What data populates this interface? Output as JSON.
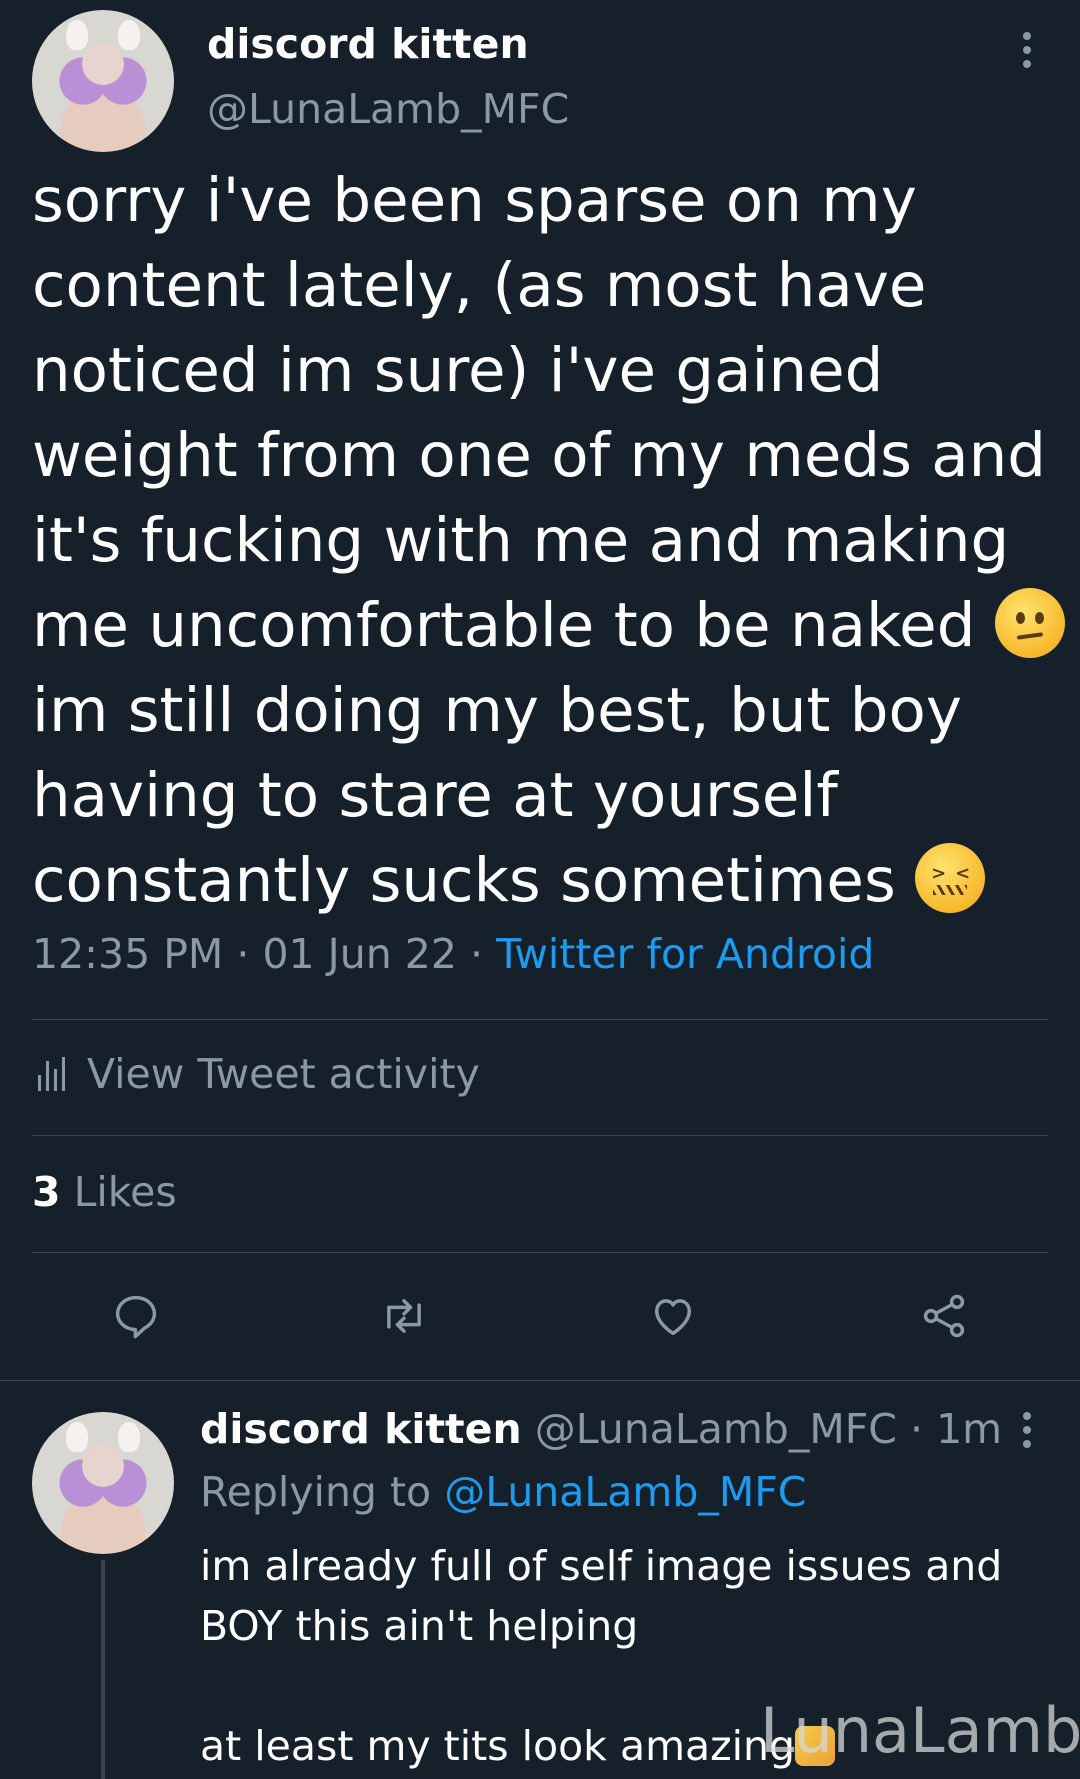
{
  "tweet": {
    "author_name": "discord kitten",
    "author_handle": "@LunaLamb_MFC",
    "text_lines": [
      "sorry i've been sparse on my",
      "content lately, (as most have",
      "noticed im sure) i've gained",
      "weight from one of my meds and",
      "it's fucking with me and making",
      "me uncomfortable to be naked",
      "im still doing my best, but boy",
      "having to stare at yourself",
      "constantly sucks sometimes"
    ],
    "emoji_1": "confused-face",
    "emoji_2": "confounded-face",
    "time": "12:35 PM",
    "date": "01 Jun 22",
    "separator": "·",
    "source": "Twitter for Android"
  },
  "activity_label": "View Tweet activity",
  "likes": {
    "count": "3",
    "label": "Likes"
  },
  "actions": [
    "reply-icon",
    "retweet-icon",
    "like-icon",
    "share-icon"
  ],
  "reply": {
    "author_name": "discord kitten",
    "author_handle": "@LunaLamb_MFC",
    "age": "1m",
    "separator": "·",
    "replying_prefix": "Replying to",
    "replying_to": "@LunaLamb_MFC",
    "text_lines": [
      "im already full of self image issues and",
      "BOY this ain't helping",
      "",
      "at least my tits look amazing"
    ]
  },
  "watermark": "LunaLamb",
  "colors": {
    "background": "#15202b",
    "text": "#ffffff",
    "secondary": "#8b98a5",
    "link": "#1d9bf0",
    "divider": "#38444d"
  }
}
